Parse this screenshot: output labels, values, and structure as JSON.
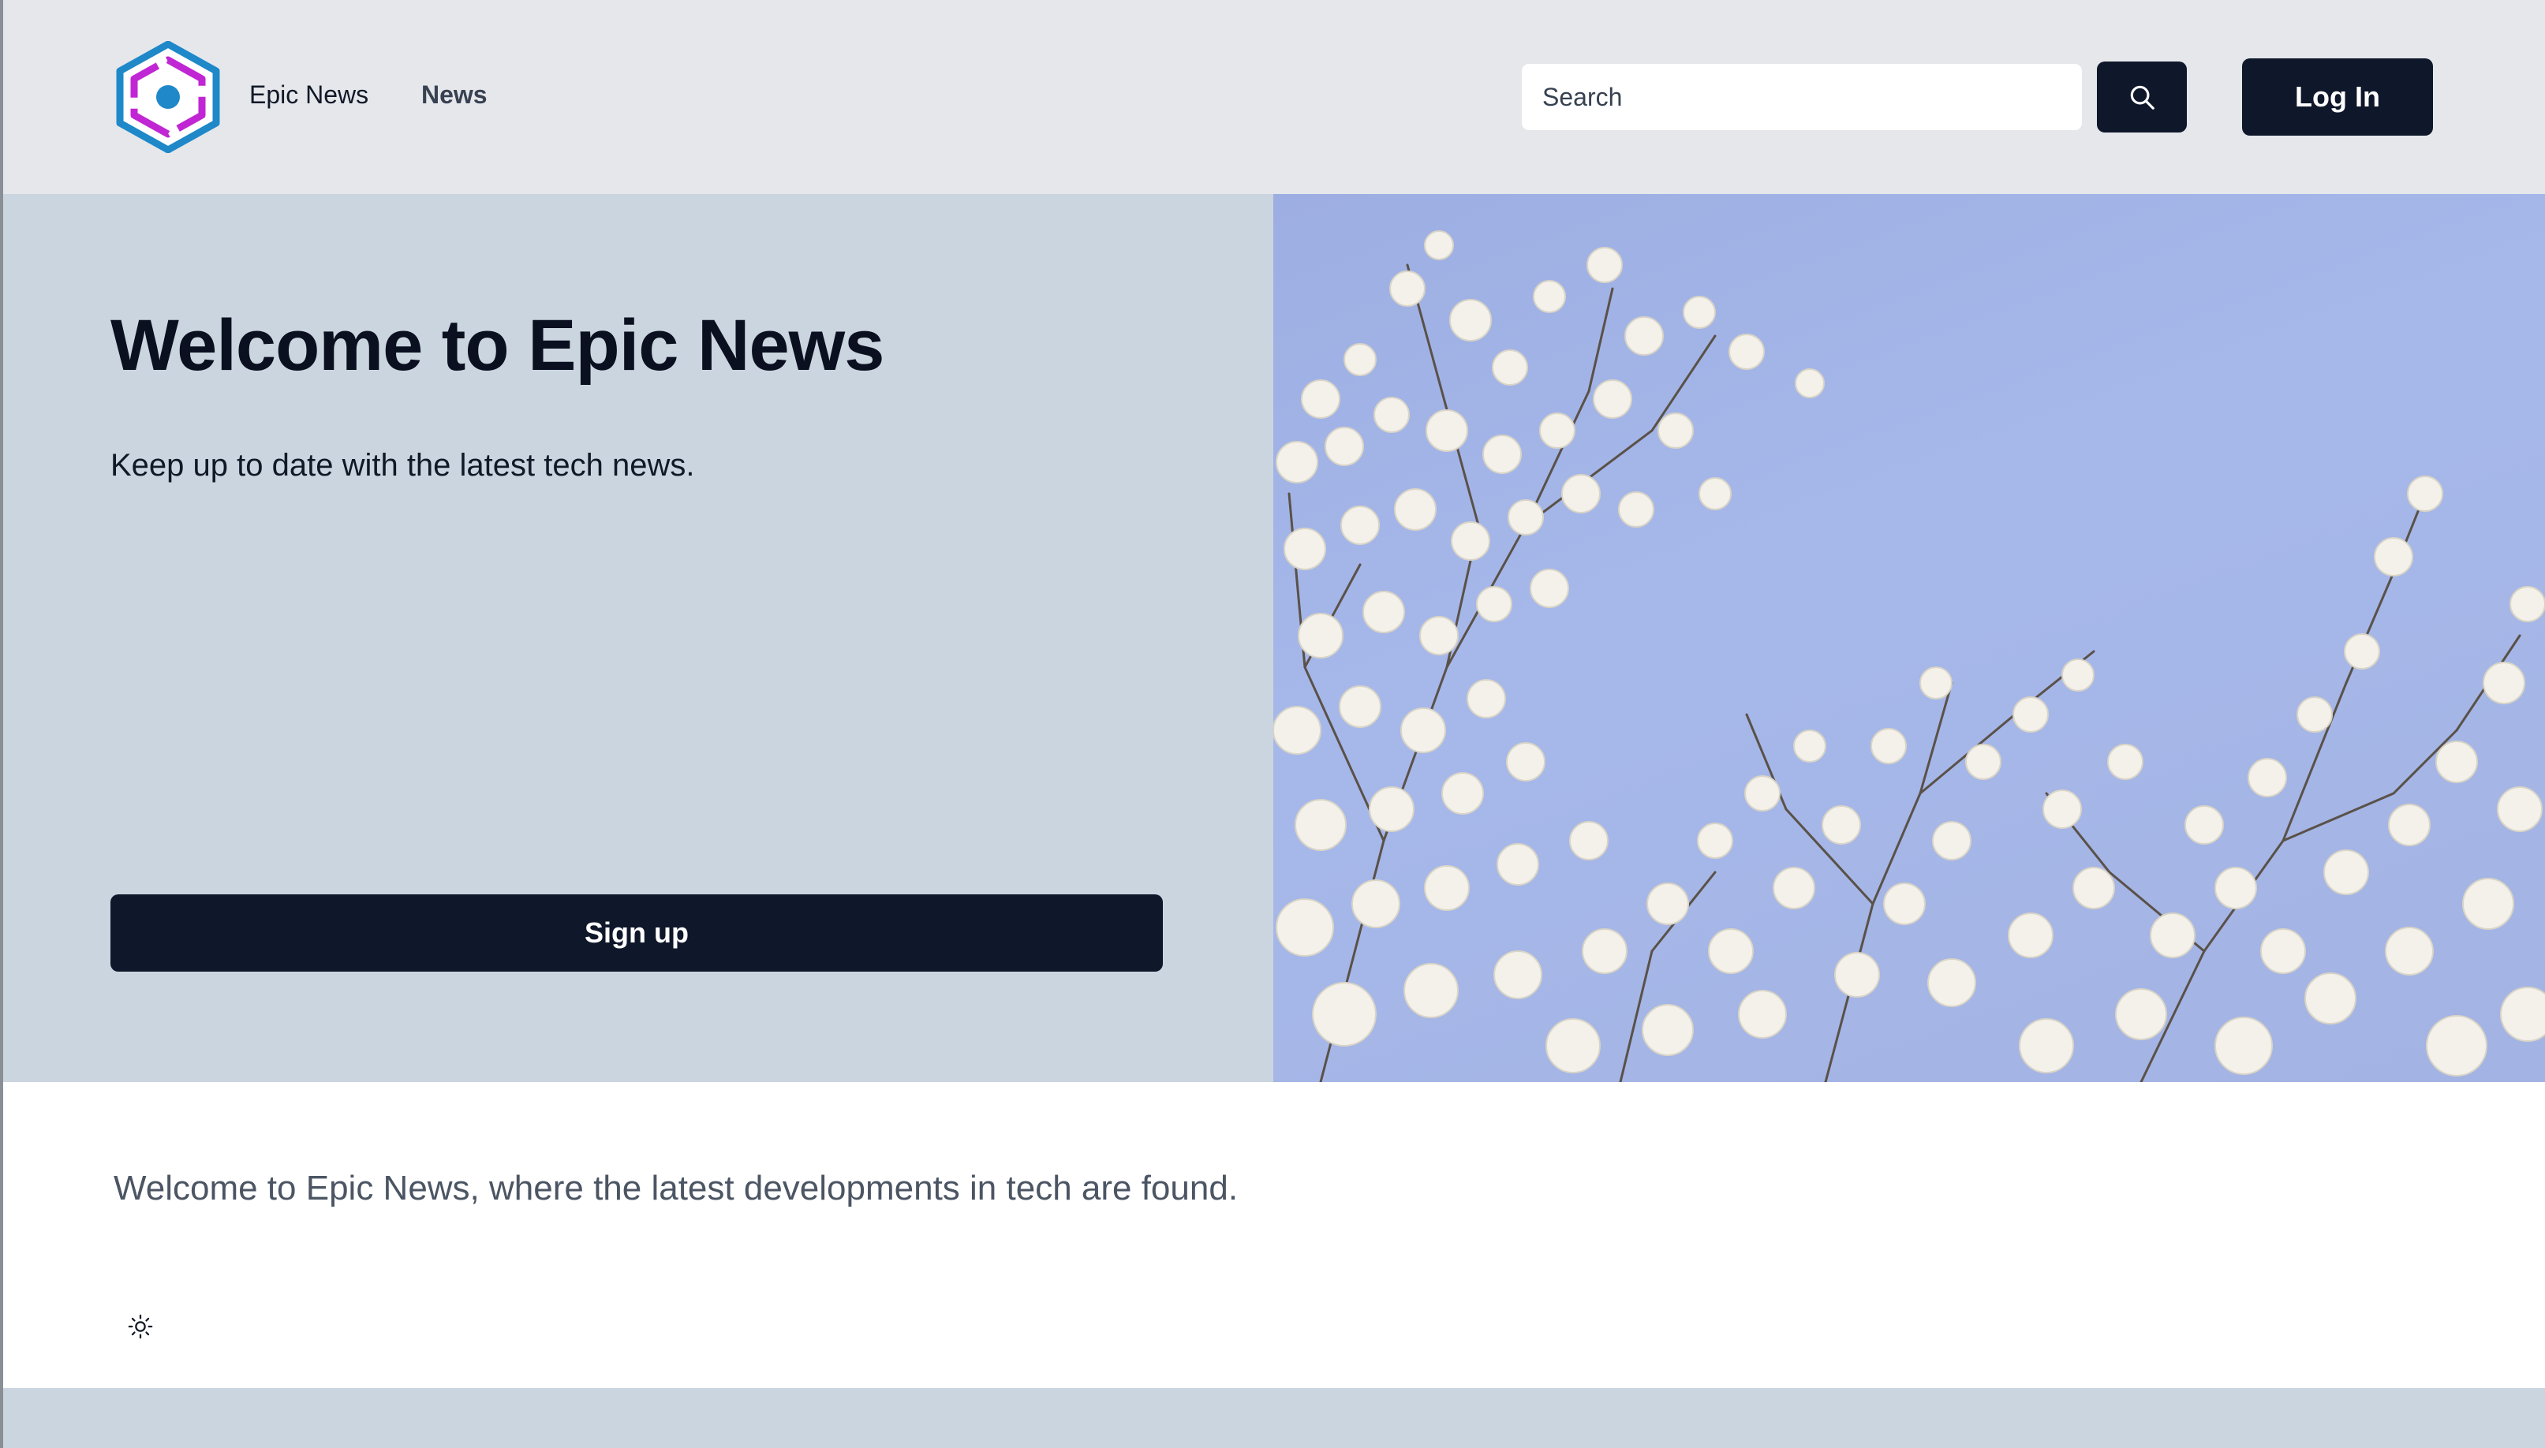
{
  "header": {
    "brand_name": "Epic News",
    "nav": [
      {
        "label": "News"
      }
    ],
    "search": {
      "placeholder": "Search",
      "value": ""
    },
    "login_label": "Log In"
  },
  "hero": {
    "title": "Welcome to Epic News",
    "subtitle": "Keep up to date with the latest tech news.",
    "signup_label": "Sign up",
    "image_icon": "flowering-tree-photo"
  },
  "main": {
    "intro_text": "Welcome to Epic News, where the latest developments in tech are found."
  },
  "footer": {
    "theme_icon": "sun-icon"
  },
  "colors": {
    "header_bg": "#e5e7eb",
    "hero_bg": "#cbd5df",
    "primary_button": "#0f172a",
    "sky": "#a3b3e3",
    "logo_blue": "#1e88c8",
    "logo_magenta": "#c026d3"
  }
}
